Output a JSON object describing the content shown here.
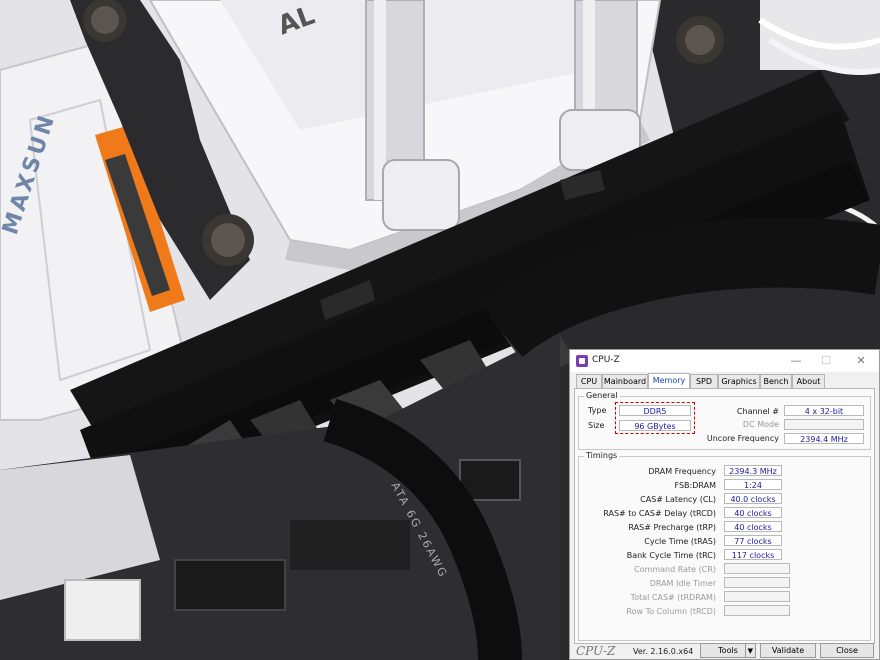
{
  "window": {
    "title": "CPU-Z",
    "controls": {
      "minimize": "—",
      "maximize": "☐",
      "close": "✕"
    }
  },
  "tabs": [
    {
      "label": "CPU"
    },
    {
      "label": "Mainboard"
    },
    {
      "label": "Memory",
      "active": true
    },
    {
      "label": "SPD"
    },
    {
      "label": "Graphics"
    },
    {
      "label": "Bench"
    },
    {
      "label": "About"
    }
  ],
  "general": {
    "title": "General",
    "type_label": "Type",
    "type_value": "DDR5",
    "size_label": "Size",
    "size_value": "96 GBytes",
    "channel_label": "Channel #",
    "channel_value": "4 x 32-bit",
    "dcmode_label": "DC Mode",
    "dcmode_value": "",
    "uncore_label": "Uncore Frequency",
    "uncore_value": "2394.4 MHz"
  },
  "timings": {
    "title": "Timings",
    "rows": [
      {
        "label": "DRAM Frequency",
        "value": "2394.3 MHz",
        "dim": false
      },
      {
        "label": "FSB:DRAM",
        "value": "1:24",
        "dim": false
      },
      {
        "label": "CAS# Latency (CL)",
        "value": "40.0 clocks",
        "dim": false
      },
      {
        "label": "RAS# to CAS# Delay (tRCD)",
        "value": "40 clocks",
        "dim": false
      },
      {
        "label": "RAS# Precharge (tRP)",
        "value": "40 clocks",
        "dim": false
      },
      {
        "label": "Cycle Time (tRAS)",
        "value": "77 clocks",
        "dim": false
      },
      {
        "label": "Bank Cycle Time (tRC)",
        "value": "117 clocks",
        "dim": false
      },
      {
        "label": "Command Rate (CR)",
        "value": "",
        "dim": true
      },
      {
        "label": "DRAM Idle Timer",
        "value": "",
        "dim": true
      },
      {
        "label": "Total CAS# (tRDRAM)",
        "value": "",
        "dim": true
      },
      {
        "label": "Row To Column (tRCD)",
        "value": "",
        "dim": true
      }
    ]
  },
  "footer": {
    "brand": "CPU-Z",
    "version": "Ver. 2.16.0.x64",
    "tools": "Tools",
    "tools_arrow": "▼",
    "validate": "Validate",
    "close": "Close"
  },
  "photo": {
    "board_text": "MAXSUN",
    "cable_text": "ATA 6G 26AWG",
    "pump_text": "AL",
    "colors": {
      "ram": "#111111",
      "board": "#e8e8ec",
      "accent": "#f07a1a",
      "tubes": "#d8d8dc"
    }
  }
}
